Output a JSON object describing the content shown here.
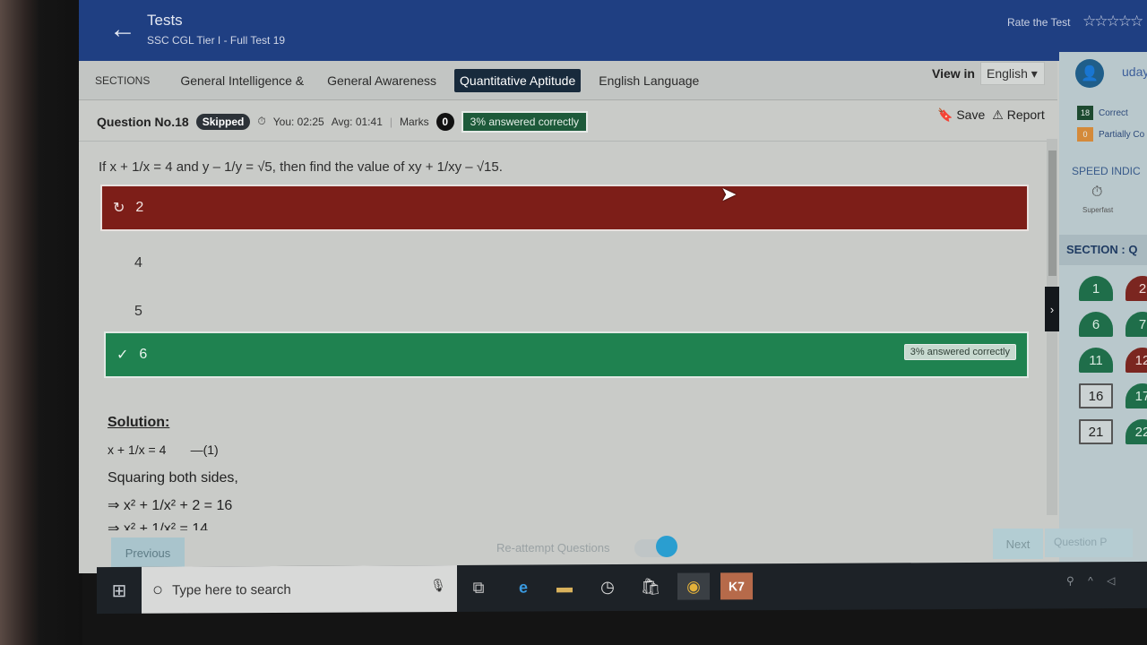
{
  "header": {
    "back_icon": "arrow-left-icon",
    "title": "Tests",
    "subtitle": "SSC CGL Tier I - Full Test 19",
    "rate_label": "Rate the Test",
    "stars": "☆☆☆☆☆"
  },
  "sections": {
    "label": "SECTIONS",
    "tabs": [
      {
        "label": "General Intelligence &"
      },
      {
        "label": "General Awareness"
      },
      {
        "label": "Quantitative Aptitude",
        "active": true
      },
      {
        "label": "English Language"
      }
    ],
    "view_in_label": "View in",
    "language": "English ▾"
  },
  "question_bar": {
    "number": "Question No.18",
    "status": "Skipped",
    "you_time": "You: 02:25",
    "avg_time": "Avg: 01:41",
    "marks_label": "Marks",
    "marks": "0",
    "answered_correctly": "3% answered correctly",
    "save": "Save",
    "report": "Report"
  },
  "question": {
    "text": "If x + 1/x = 4 and y – 1/y = √5, then find the value of xy + 1/xy – √15.",
    "options": [
      {
        "label": "2",
        "state": "wrong",
        "icon": "undo-icon"
      },
      {
        "label": "4",
        "state": "none"
      },
      {
        "label": "5",
        "state": "none"
      },
      {
        "label": "6",
        "state": "correct",
        "icon": "check-icon",
        "badge": "3% answered correctly"
      }
    ]
  },
  "solution": {
    "title": "Solution:",
    "lines": [
      "x + 1/x = 4       —(1)",
      "Squaring both sides,",
      "⇒ x² + 1/x² + 2 = 16",
      "⇒ x² + 1/x² = 14"
    ]
  },
  "footer": {
    "previous": "Previous",
    "reattempt": "Re-attempt Questions",
    "next": "Next",
    "question_palette": "Question P"
  },
  "sidebar": {
    "username": "uday",
    "correct_count": "18",
    "correct_label": "Correct",
    "partial_count": "0",
    "partial_label": "Partially Co",
    "speed_label": "SPEED INDIC",
    "speed_value": "Superfast",
    "section_label": "SECTION : Q",
    "palette": [
      {
        "n": "1",
        "s": "ok"
      },
      {
        "n": "2",
        "s": "bad"
      },
      {
        "n": "6",
        "s": "ok"
      },
      {
        "n": "7",
        "s": "ok"
      },
      {
        "n": "11",
        "s": "ok"
      },
      {
        "n": "12",
        "s": "bad"
      },
      {
        "n": "16",
        "s": "un"
      },
      {
        "n": "17",
        "s": "ok"
      },
      {
        "n": "21",
        "s": "un"
      },
      {
        "n": "22",
        "s": "ok"
      }
    ]
  },
  "taskbar": {
    "search_placeholder": "Type here to search"
  },
  "colors": {
    "header": "#1f3f82",
    "wrong": "#7d1e18",
    "correct": "#1f8250",
    "active_tab": "#182a3c"
  }
}
